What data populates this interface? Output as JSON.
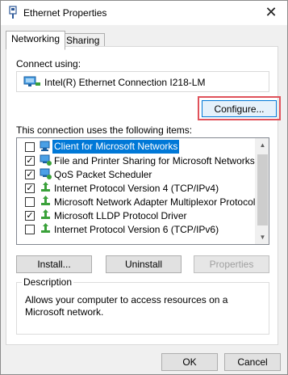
{
  "window": {
    "title": "Ethernet Properties",
    "close_glyph": "✕"
  },
  "tabs": [
    {
      "label": "Networking",
      "active": true
    },
    {
      "label": "Sharing",
      "active": false
    }
  ],
  "connect_using": {
    "label": "Connect using:",
    "adapter": "Intel(R) Ethernet Connection I218-LM",
    "adapter_icon": "network-adapter-icon",
    "configure_label": "Configure...",
    "highlight_color": "#e0525b"
  },
  "items": {
    "label": "This connection uses the following items:",
    "list": [
      {
        "text": "Client for Microsoft Networks",
        "checked": false,
        "icon": "network-client-icon",
        "selected": true
      },
      {
        "text": "File and Printer Sharing for Microsoft Networks",
        "checked": true,
        "icon": "network-service-icon",
        "selected": false
      },
      {
        "text": "QoS Packet Scheduler",
        "checked": true,
        "icon": "network-service-icon",
        "selected": false
      },
      {
        "text": "Internet Protocol Version 4 (TCP/IPv4)",
        "checked": true,
        "icon": "protocol-icon",
        "selected": false
      },
      {
        "text": "Microsoft Network Adapter Multiplexor Protocol",
        "checked": false,
        "icon": "protocol-icon",
        "selected": false
      },
      {
        "text": "Microsoft LLDP Protocol Driver",
        "checked": true,
        "icon": "protocol-icon",
        "selected": false
      },
      {
        "text": "Internet Protocol Version 6 (TCP/IPv6)",
        "checked": false,
        "icon": "protocol-icon",
        "selected": false
      }
    ]
  },
  "buttons": {
    "install": "Install...",
    "uninstall": "Uninstall",
    "properties": "Properties",
    "ok": "OK",
    "cancel": "Cancel"
  },
  "description": {
    "legend": "Description",
    "text": "Allows your computer to access resources on a Microsoft network."
  },
  "colors": {
    "selection": "#0078d7",
    "highlight": "#e0525b"
  }
}
